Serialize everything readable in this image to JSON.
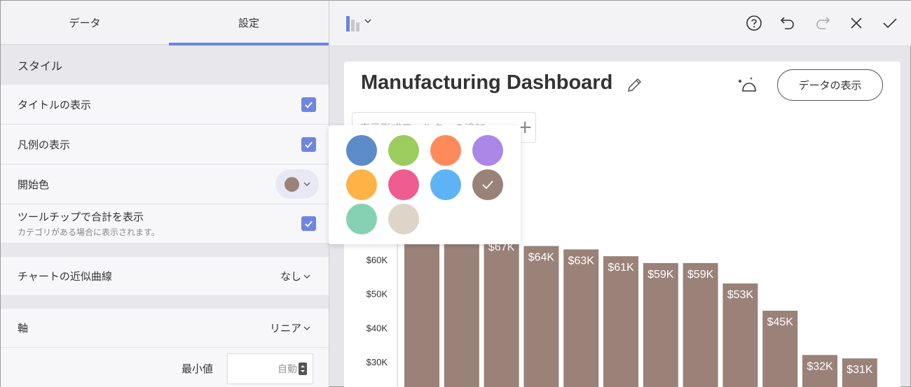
{
  "left_panel": {
    "tabs": [
      {
        "label": "データ"
      },
      {
        "label": "設定"
      }
    ],
    "style_section": "スタイル",
    "show_title": "タイトルの表示",
    "show_legend": "凡例の表示",
    "start_color": "開始色",
    "tooltip_total": "ツールチップで合計を表示",
    "tooltip_total_sub": "カテゴリがある場合に表示されます。",
    "trendline": {
      "label": "チャートの近似曲線",
      "value": "なし"
    },
    "axis": {
      "label": "軸",
      "value": "リニア"
    },
    "min_value": {
      "label": "最小値",
      "value": "自動"
    }
  },
  "toolbar": {
    "icons": [
      "bar-chart-icon",
      "help-icon",
      "undo-icon",
      "redo-icon",
      "close-icon",
      "check-icon"
    ]
  },
  "dashboard": {
    "title": "Manufacturing Dashboard",
    "show_data_button": "データの表示",
    "filter_placeholder": "表示形式フィルターの追加"
  },
  "color_palette": {
    "colors": [
      "#5b8cc9",
      "#9ccc5e",
      "#ff8a5c",
      "#ab87e8",
      "#ffb246",
      "#ef5c8f",
      "#5eb3f5",
      "#9a8279",
      "#86d1b4",
      "#dfd4c8"
    ],
    "selected_index": 7
  },
  "chart_data": {
    "type": "bar",
    "y_ticks": [
      "$30K",
      "$40K",
      "$50K",
      "$60K"
    ],
    "values": [
      70,
      70,
      67,
      64,
      63,
      61,
      59,
      59,
      53,
      45,
      32,
      31
    ],
    "labels": [
      "",
      "",
      "$67K",
      "$64K",
      "$63K",
      "$61K",
      "$59K",
      "$59K",
      "$53K",
      "$45K",
      "$32K",
      "$31K"
    ],
    "bar_color": "#9a8279",
    "ylim": [
      20,
      80
    ]
  }
}
